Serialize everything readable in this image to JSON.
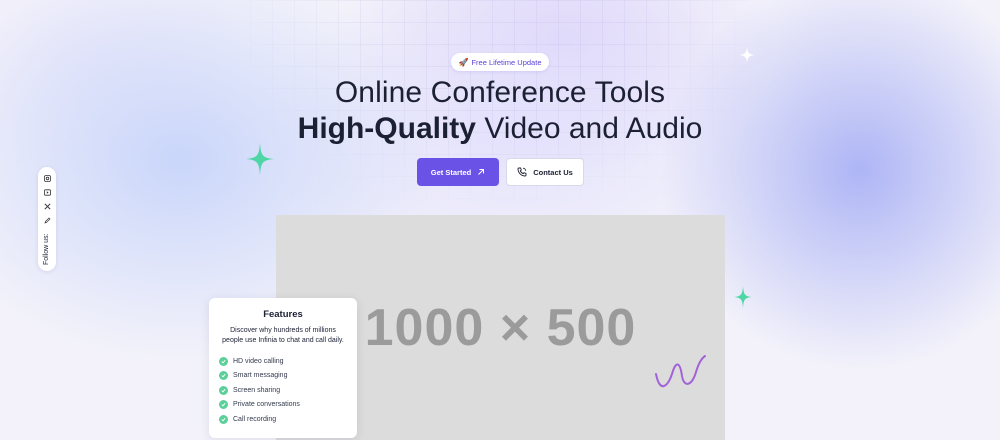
{
  "badge": {
    "icon": "rocket-icon",
    "label": "Free Lifetime Update"
  },
  "hero": {
    "line1": "Online Conference Tools",
    "line2_bold": "High-Quality",
    "line2_rest": "Video and Audio"
  },
  "buttons": {
    "primary": {
      "label": "Get Started",
      "icon": "arrow-up-right-icon"
    },
    "secondary": {
      "label": "Contact Us",
      "icon": "phone-icon"
    }
  },
  "follow": {
    "label": "Follow us:",
    "icons": [
      "instagram-icon",
      "youtube-icon",
      "x-icon",
      "pen-icon"
    ]
  },
  "media": {
    "placeholder_text": "1000 × 500"
  },
  "features": {
    "title": "Features",
    "description": "Discover why hundreds of millions people use Infinia to chat and call daily.",
    "items": [
      "HD video calling",
      "Smart messaging",
      "Screen sharing",
      "Private conversations",
      "Call recording"
    ]
  },
  "colors": {
    "accent": "#6b52e6",
    "check": "#5ccf9a",
    "sparkle_green": "#4fd6a6",
    "squiggle": "#a363d8"
  }
}
